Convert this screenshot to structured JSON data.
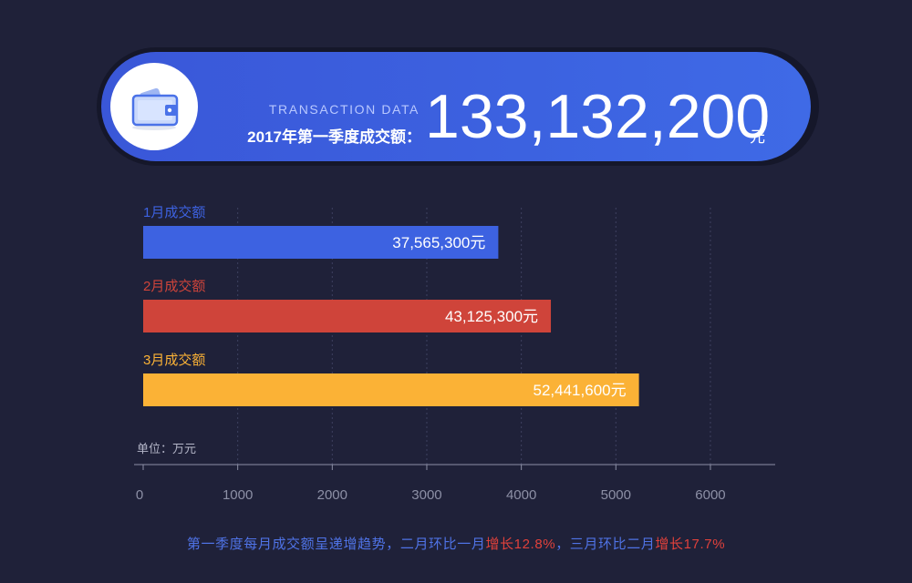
{
  "colors": {
    "background": "#1f2139",
    "banner": "#3c5fdd",
    "jan": "#3d62e1",
    "feb": "#cf443a",
    "mar": "#fbb236",
    "axis": "#8d90a6",
    "caption": "#4f73e6",
    "highlight": "#e0413b"
  },
  "banner": {
    "icon": "wallet-icon",
    "subtitle": "TRANSACTION DATA",
    "label": "2017年第一季度成交额：",
    "total": "133,132,200",
    "unit": "元"
  },
  "chart_data": {
    "type": "bar",
    "orientation": "horizontal",
    "unit_label": "单位：万元",
    "categories": [
      "1月成交额",
      "2月成交额",
      "3月成交额"
    ],
    "values": [
      3756.53,
      4312.53,
      5244.16
    ],
    "value_labels": [
      "37,565,300元",
      "43,125,300元",
      "52,441,600元"
    ],
    "xlim": [
      0,
      6600
    ],
    "xticks": [
      0,
      1000,
      2000,
      3000,
      4000,
      5000,
      6000
    ],
    "grid": true,
    "legend": "none"
  },
  "caption": {
    "part1": "第一季度每月成交额呈递增趋势，二月环比一月",
    "hl1": "增长12.8%",
    "part2": "，三月环比二月",
    "hl2": "增长17.7%"
  }
}
